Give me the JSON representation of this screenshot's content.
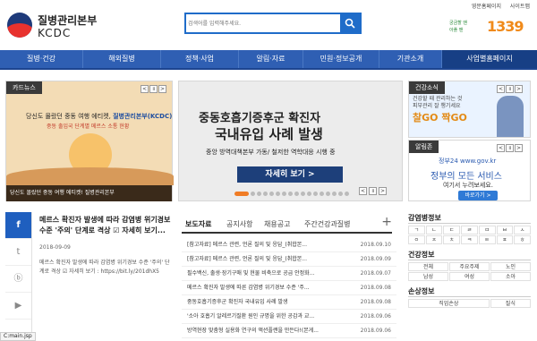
{
  "header": {
    "logo_kr": "질병관리본부",
    "logo_en": "KCDC",
    "search_placeholder": "검색어를 입력해주세요.",
    "top_links": [
      "영문홈페이지",
      "사이트맵"
    ],
    "hotline_small_1": "궁금할 땐",
    "hotline_small_2": "아플 땐",
    "hotline_number": "1339"
  },
  "nav": [
    "질병·건강",
    "해외질병",
    "정책·사업",
    "알림·자료",
    "민원·정보공개",
    "기관소개",
    "사업별홈페이지"
  ],
  "cardnews": {
    "label": "카드뉴스",
    "headline_prefix": "당신도 몰랐던 중동 여행 에티켓,",
    "headline_brand": "질병관리본부(KCDC)",
    "subline": "중동 출입국 단계별 메르스 소통 현황",
    "caption": "당신도 몰랐던 중동 여행 에티켓! 질병관리본부"
  },
  "banner": {
    "line1": "중동호흡기증후군 확진자",
    "line2": "국내유입 사례 발생",
    "line3": "중앙 방역대책본부 가동/ 철저한 역학대응 시행 중",
    "more": "자세히 보기 >"
  },
  "health": {
    "label": "건강소식",
    "ad_line1": "건강할 때 관리하는 것",
    "ad_line2": "피부관리 잘 챙기세요",
    "go_text": "찰GO 짝GO"
  },
  "gov": {
    "label": "알림존",
    "brand": "정부24 www.gov.kr",
    "text1": "정부의 모든 서비스",
    "text2": "여기서 누려보세요.",
    "go": "바로가기 >"
  },
  "social": [
    "f",
    "t",
    "ⓑ",
    "▶"
  ],
  "post": {
    "title": "메르스 확진자 발생에 따라 감염병 위기경보 수준 '주의' 단계로 격상 ☑ 자세히 보기...",
    "date": "2018-09-09",
    "body": "메르스 확진자 발생에 따라 감염병 위기경보 수준 '주의' 단계로 격상 ☑ 자세히 보기 : https://bit.ly/201dhX5"
  },
  "tabs": [
    "보도자료",
    "공지사항",
    "채용공고",
    "주간건강과질병"
  ],
  "news": [
    {
      "title": "[참고자료] 메르스 관련, 언론 질의 및 응답_(취합본...",
      "date": "2018.09.10"
    },
    {
      "title": "[참고자료] 메르스 관련, 언론 질의 및 응답_(취합본...",
      "date": "2018.09.09"
    },
    {
      "title": "필수백신, 출생·장기구매 및 현물 비축으로 공급 안정화...",
      "date": "2018.09.07"
    },
    {
      "title": "메르스 확진자 발생에 따른 감염병 위기경보 수준 '주...",
      "date": "2018.09.08"
    },
    {
      "title": "중동호흡기증후군 확진자 국내유입 사례 발생",
      "date": "2018.09.08"
    },
    {
      "title": "'소아 호흡기 알레르기질환 원인 규명을 위한 공감과 교...",
      "date": "2018.09.06"
    },
    {
      "title": "방역현장 맞춤형 실용화 연구의 액션플랜을 만든다!(본게...",
      "date": "2018.09.06"
    }
  ],
  "side": {
    "disease_title": "감염병정보",
    "consonants": [
      "ㄱ",
      "ㄴ",
      "ㄷ",
      "ㄹ",
      "ㅁ",
      "ㅂ",
      "ㅅ",
      "ㅇ",
      "ㅈ",
      "ㅊ",
      "ㅋ",
      "ㅌ",
      "ㅍ",
      "ㅎ"
    ],
    "health_title": "건강정보",
    "health_items": [
      "전체",
      "주요주제",
      "노인",
      "남성",
      "여성",
      "소아"
    ],
    "loss_title": "손상정보",
    "loss_items": [
      "직업손상",
      "질식"
    ]
  },
  "status": "C:main.jsp",
  "colors": {
    "nav": "#2f5fb3",
    "accent": "#f07c25",
    "search": "#1f6cc9"
  }
}
